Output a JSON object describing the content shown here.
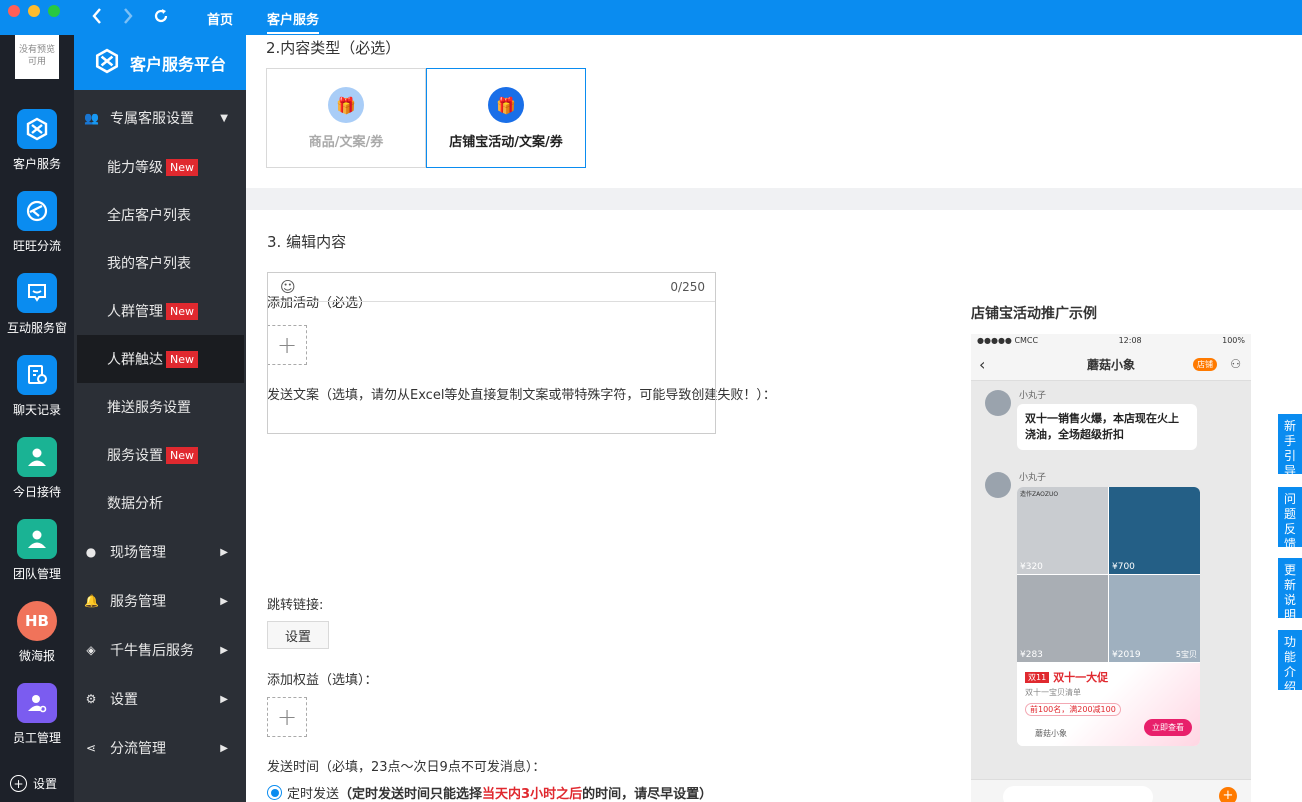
{
  "window": {
    "nav_home": "首页",
    "nav_current": "客户服务"
  },
  "icon_sidebar": {
    "avatar_text": "没有预览可用",
    "items": [
      {
        "label": "客户服务",
        "icon": "customer-service-icon",
        "color": "#0a8cf0"
      },
      {
        "label": "旺旺分流",
        "icon": "ww-split-icon",
        "color": "#0a8cf0"
      },
      {
        "label": "互动服务窗",
        "icon": "interactive-window-icon",
        "color": "#0a8cf0"
      },
      {
        "label": "聊天记录",
        "icon": "chat-record-icon",
        "color": "#0a8cf0"
      },
      {
        "label": "今日接待",
        "icon": "today-reception-icon",
        "color": "#1ab394"
      },
      {
        "label": "团队管理",
        "icon": "team-icon",
        "color": "#1ab394"
      },
      {
        "label": "微海报",
        "icon": "poster-icon",
        "color": "#f0735a"
      },
      {
        "label": "员工管理",
        "icon": "staff-icon",
        "color": "#7b5cf0"
      }
    ],
    "settings_label": "设置"
  },
  "menu": {
    "platform_title": "客户服务平台",
    "group_label": "专属客服设置",
    "sub_items": [
      {
        "label": "能力等级",
        "badge": "New"
      },
      {
        "label": "全店客户列表",
        "badge": ""
      },
      {
        "label": "我的客户列表",
        "badge": ""
      },
      {
        "label": "人群管理",
        "badge": "New"
      },
      {
        "label": "人群触达",
        "badge": "New"
      },
      {
        "label": "推送服务设置",
        "badge": ""
      },
      {
        "label": "服务设置",
        "badge": "New"
      },
      {
        "label": "数据分析",
        "badge": ""
      }
    ],
    "top_items": [
      "现场管理",
      "服务管理",
      "千牛售后服务",
      "设置",
      "分流管理"
    ]
  },
  "content_type": {
    "heading": "2.内容类型（必选）",
    "option1": "商品/文案/券",
    "option2": "店铺宝活动/文案/券"
  },
  "edit": {
    "heading": "3. 编辑内容",
    "add_activity_label": "添加活动（必选）",
    "copy_label": "发送文案（选填，请勿从Excel等处直接复制文案或带特殊字符，可能导致创建失败！）：",
    "char_count": "0/250",
    "link_label": "跳转链接:",
    "set_button": "设置",
    "benefit_label": "添加权益（选填）：",
    "send_time_label": "发送时间（必填，23点～次日9点不可发消息）：",
    "radio_label": "定时发送",
    "radio_note_a": "（定时发送时间只能选择",
    "radio_note_red": "当天内3小时之后",
    "radio_note_b": "的时间，请尽早设置）"
  },
  "preview": {
    "title": "店铺宝活动推广示例",
    "carrier": "●●●●● CMCC",
    "time": "12:08",
    "battery": "100%",
    "shop": "蘑菇小象",
    "shop_tag": "店铺",
    "sender1": "小丸子",
    "msg": "双十一销售火爆，本店现在火上浇油，全场超级折扣",
    "sender2": "小丸子",
    "brand": "造作ZAOZUO",
    "prices": [
      "¥320",
      "¥700",
      "¥283",
      "¥2019"
    ],
    "count": "5宝贝",
    "promo_tag": "双11",
    "promo_title": "双十一大促",
    "promo_sub": "双十一宝贝清单",
    "promo_coupon": "前100名，满200减100",
    "shop_small": "蘑菇小象",
    "cta": "立即查看"
  },
  "side_tabs": [
    "新手引导",
    "问题反馈",
    "更新说明",
    "功能介绍"
  ]
}
